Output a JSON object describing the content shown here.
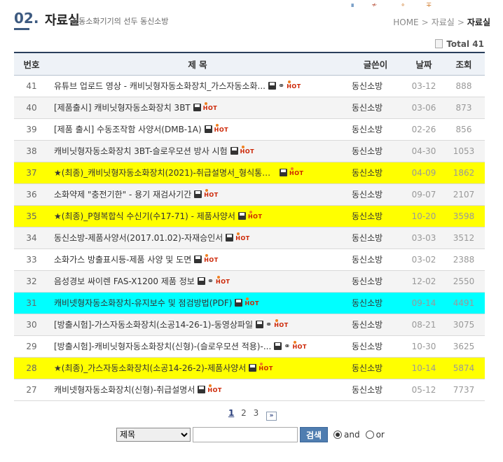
{
  "header": {
    "section_number": "02",
    "section_dot": ".",
    "title": "자료실",
    "subtitle": "자동소화기기의 선두 동신소방"
  },
  "breadcrumb": [
    "HOME",
    "자료실",
    "자료실"
  ],
  "total": {
    "label": "Total",
    "count": "41"
  },
  "table": {
    "columns": [
      "번호",
      "제 목",
      "글쓴이",
      "날짜",
      "조회"
    ],
    "rows": [
      {
        "no": "41",
        "title": "유튜브 업로드 영상 - 캐비닛형자동소화장치_가스자동소화...",
        "file": true,
        "link": true,
        "hot": true,
        "author": "동신소방",
        "date": "03-12",
        "views": "888",
        "highlight": "none"
      },
      {
        "no": "40",
        "title": "[제품출시] 캐비닛형자동소화장치 3BT",
        "file": true,
        "link": false,
        "hot": true,
        "author": "동신소방",
        "date": "03-06",
        "views": "873",
        "highlight": "none"
      },
      {
        "no": "39",
        "title": "[제품 출시] 수동조작함 사양서(DMB-1A)",
        "file": true,
        "link": false,
        "hot": true,
        "author": "동신소방",
        "date": "02-26",
        "views": "856",
        "highlight": "none"
      },
      {
        "no": "38",
        "title": "캐비닛형자동소화장치 3BT-슬로우모션 방사 시험",
        "file": true,
        "link": false,
        "hot": true,
        "author": "동신소방",
        "date": "04-30",
        "views": "1053",
        "highlight": "none"
      },
      {
        "no": "37",
        "title": "★(최종)_캐비닛형자동소화장치(2021)-취급설명서_형식통합...",
        "file": true,
        "link": false,
        "hot": true,
        "author": "동신소방",
        "date": "04-09",
        "views": "1862",
        "highlight": "yellow"
      },
      {
        "no": "36",
        "title": "소화약제 \"충전기한\" - 용기 재검사기간",
        "file": true,
        "link": false,
        "hot": true,
        "author": "동신소방",
        "date": "09-07",
        "views": "2107",
        "highlight": "none"
      },
      {
        "no": "35",
        "title": "★(최종)_P형복합식 수신기(수17-71) - 제품사양서",
        "file": true,
        "link": false,
        "hot": true,
        "author": "동신소방",
        "date": "10-20",
        "views": "3598",
        "highlight": "yellow"
      },
      {
        "no": "34",
        "title": "동신소방-제품사양서(2017.01.02)-자재승인서",
        "file": true,
        "link": false,
        "hot": true,
        "author": "동신소방",
        "date": "03-03",
        "views": "3512",
        "highlight": "none"
      },
      {
        "no": "33",
        "title": "소화가스 방출표시등-제품 사양 및 도면",
        "file": true,
        "link": false,
        "hot": true,
        "author": "동신소방",
        "date": "03-02",
        "views": "2388",
        "highlight": "none"
      },
      {
        "no": "32",
        "title": "음성경보 싸이렌 FAS-X1200 제품 정보",
        "file": true,
        "link": true,
        "hot": true,
        "author": "동신소방",
        "date": "12-02",
        "views": "2550",
        "highlight": "none"
      },
      {
        "no": "31",
        "title": "캐비넷형자동소화장치-유지보수 및 점검방법(PDF)",
        "file": true,
        "link": false,
        "hot": true,
        "author": "동신소방",
        "date": "09-14",
        "views": "4491",
        "highlight": "cyan"
      },
      {
        "no": "30",
        "title": "[방출시험]-가스자동소화장치(소공14-26-1)-동영상파일",
        "file": true,
        "link": true,
        "hot": true,
        "author": "동신소방",
        "date": "08-21",
        "views": "3075",
        "highlight": "none"
      },
      {
        "no": "29",
        "title": "[방출시험]-캐비닛형자동소화장치(신형)-(슬로우모션 적용)-...",
        "file": true,
        "link": true,
        "hot": true,
        "author": "동신소방",
        "date": "10-30",
        "views": "3625",
        "highlight": "none"
      },
      {
        "no": "28",
        "title": "★(최종)_가스자동소화장치(소공14-26-2)-제품사양서",
        "file": true,
        "link": false,
        "hot": true,
        "author": "동신소방",
        "date": "10-14",
        "views": "5874",
        "highlight": "yellow"
      },
      {
        "no": "27",
        "title": "캐비넷형자동소화장치(신형)-취급설명서",
        "file": true,
        "link": false,
        "hot": true,
        "author": "동신소방",
        "date": "05-12",
        "views": "7737",
        "highlight": "none"
      }
    ]
  },
  "badge_text": "HOT",
  "pagination": {
    "pages": [
      "1",
      "2",
      "3"
    ],
    "current": "1",
    "next_symbol": "»"
  },
  "search": {
    "field_options": [
      "제목"
    ],
    "selected": "제목",
    "query": "",
    "button_label": "검색",
    "logic_options": [
      "and",
      "or"
    ],
    "logic_selected": "and"
  },
  "colors": {
    "highlight_yellow": "#ffff00",
    "highlight_cyan": "#00ffff",
    "header_accent": "#3d5a80",
    "search_button": "#4f7db0"
  }
}
